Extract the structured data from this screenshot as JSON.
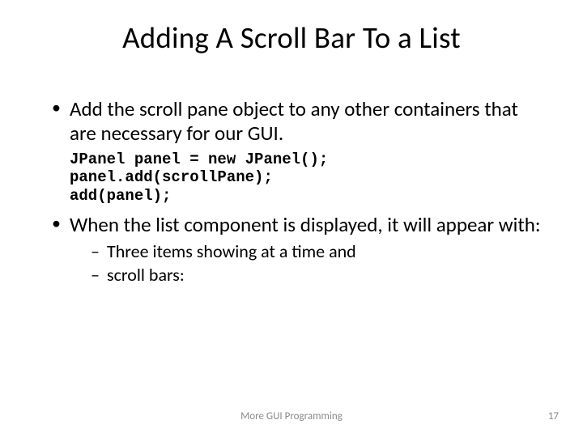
{
  "title": "Adding A Scroll Bar To a List",
  "bullets": {
    "b1": "Add the scroll pane object to any other containers that are necessary for our GUI.",
    "code": "JPanel panel = new JPanel();\npanel.add(scrollPane);\nadd(panel);",
    "b2": "When the list component is displayed, it will appear with:",
    "sub1": "Three items showing at a time and",
    "sub2": "scroll bars:"
  },
  "footer": {
    "center": "More GUI Programming",
    "page": "17"
  }
}
